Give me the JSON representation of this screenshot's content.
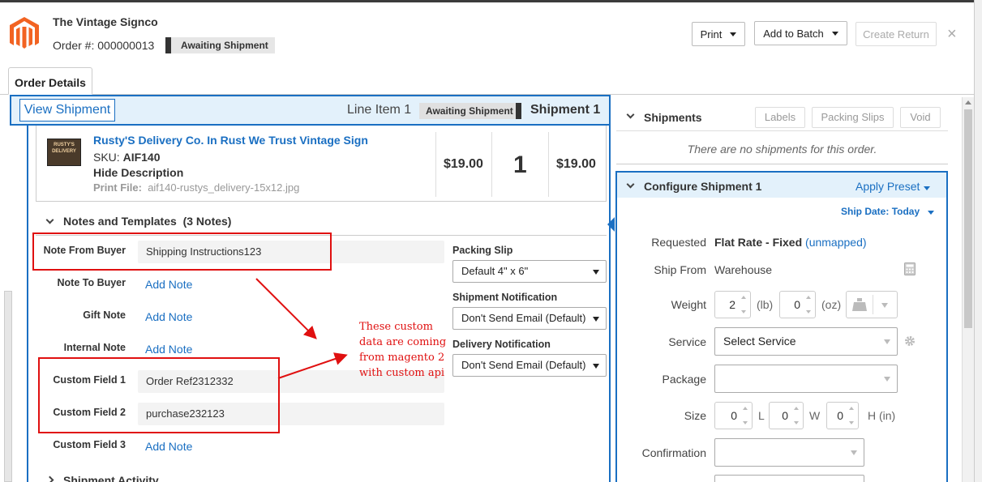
{
  "header": {
    "store_name": "The Vintage Signco",
    "order_number": "Order #: 000000013",
    "status_badge": "Awaiting Shipment",
    "print_label": "Print",
    "add_to_batch_label": "Add to Batch",
    "create_return_label": "Create Return",
    "close_glyph": "×"
  },
  "tabs": [
    {
      "label": "Order Details"
    }
  ],
  "shipment_bar": {
    "view_shipment_label": "View Shipment",
    "line_item": "Line Item 1",
    "status": "Awaiting Shipment",
    "shipment": "Shipment 1"
  },
  "line_item": {
    "thumb_text": "RUSTY'S DELIVERY",
    "name": "Rusty'S Delivery Co. In Rust We Trust Vintage Sign",
    "sku_label": "SKU:",
    "sku": "AIF140",
    "hide_description": "Hide Description",
    "print_file_label": "Print File:",
    "print_file": "aif140-rustys_delivery-15x12.jpg",
    "unit_price": "$19.00",
    "quantity": "1",
    "total": "$19.00"
  },
  "notes": {
    "section_title": "Notes and Templates",
    "count": "(3 Notes)",
    "rows": [
      {
        "label": "Note From Buyer",
        "value": "Shipping Instructions123"
      },
      {
        "label": "Note To Buyer",
        "value": "Add Note"
      },
      {
        "label": "Gift Note",
        "value": "Add Note"
      },
      {
        "label": "Internal Note",
        "value": "Add Note"
      },
      {
        "label": "Custom Field 1",
        "value": "Order Ref2312332"
      },
      {
        "label": "Custom Field 2",
        "value": "purchase232123"
      },
      {
        "label": "Custom Field 3",
        "value": "Add Note"
      }
    ],
    "packing_slip_label": "Packing Slip",
    "packing_slip_value": "Default 4\" x 6\"",
    "shipment_notification_label": "Shipment Notification",
    "shipment_notification_value": "Don't Send Email (Default)",
    "delivery_notification_label": "Delivery Notification",
    "delivery_notification_value": "Don't Send Email (Default)"
  },
  "annotation": {
    "text": "These custom data are coming from magento 2 with custom api",
    "color": "#e01010"
  },
  "shipment_activity": {
    "label": "Shipment Activity"
  },
  "shipments_panel": {
    "title": "Shipments",
    "labels_btn": "Labels",
    "packing_slips_btn": "Packing Slips",
    "void_btn": "Void",
    "empty_text": "There are no shipments for this order."
  },
  "configure": {
    "title": "Configure Shipment 1",
    "apply_preset": "Apply Preset",
    "ship_date_label": "Ship Date:",
    "ship_date_value": "Today",
    "requested_label": "Requested",
    "requested_value": "Flat Rate - Fixed",
    "requested_mapping": "(unmapped)",
    "ship_from_label": "Ship From",
    "ship_from_value": "Warehouse",
    "weight_label": "Weight",
    "weight_lb": "2",
    "weight_lb_unit": "(lb)",
    "weight_oz": "0",
    "weight_oz_unit": "(oz)",
    "service_label": "Service",
    "service_value": "Select Service",
    "package_label": "Package",
    "package_value": "",
    "size_label": "Size",
    "size_l": "0",
    "size_l_unit": "L",
    "size_w": "0",
    "size_w_unit": "W",
    "size_h": "0",
    "size_h_unit": "H (in)",
    "confirmation_label": "Confirmation",
    "confirmation_value": ""
  },
  "colors": {
    "accent": "#1a6fc2",
    "section_bg": "#e3f1fb",
    "logo": "#f26322"
  }
}
